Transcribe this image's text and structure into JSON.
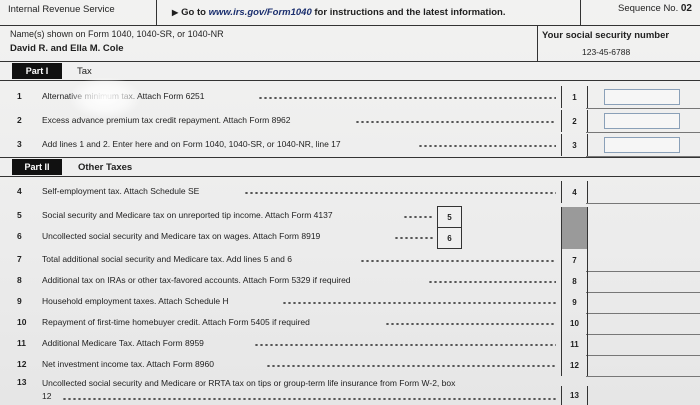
{
  "header": {
    "agency": "Internal Revenue Service",
    "instructions_prefix": "Go to",
    "instructions_url": "www.irs.gov/Form1040",
    "instructions_suffix": "for instructions and the latest information.",
    "sequence_label": "Sequence No.",
    "sequence_no": "02",
    "arrow_icon": "triangle-right"
  },
  "taxpayer": {
    "name_label": "Name(s) shown on Form 1040, 1040-SR, or 1040-NR",
    "name_value": "David R. and Ella M. Cole",
    "ssn_label": "Your social security number",
    "ssn_value": "123-45-6788"
  },
  "part1": {
    "tag": "Part I",
    "title": "Tax",
    "lines": [
      {
        "num": "1",
        "text": "Alternative minimum tax. Attach Form 6251",
        "box": "1"
      },
      {
        "num": "2",
        "text": "Excess advance premium tax credit repayment. Attach Form 8962",
        "box": "2"
      },
      {
        "num": "3",
        "text": "Add lines 1 and 2. Enter here and on Form 1040, 1040-SR, or 1040-NR, line 17",
        "box": "3"
      }
    ]
  },
  "part2": {
    "tag": "Part II",
    "title": "Other Taxes",
    "lines": [
      {
        "num": "4",
        "text": "Self-employment tax. Attach Schedule SE",
        "box": "4"
      },
      {
        "num": "5",
        "text": "Social security and Medicare tax on unreported tip income. Attach Form 4137",
        "box": "5"
      },
      {
        "num": "6",
        "text": "Uncollected social security and Medicare tax on wages. Attach Form 8919",
        "box": "6"
      },
      {
        "num": "7",
        "text": "Total additional social security and Medicare tax. Add lines 5 and 6",
        "box": "7"
      },
      {
        "num": "8",
        "text": "Additional tax on IRAs or other tax-favored accounts. Attach Form 5329 if required",
        "box": "8"
      },
      {
        "num": "9",
        "text": "Household employment taxes. Attach Schedule H",
        "box": "9"
      },
      {
        "num": "10",
        "text": "Repayment of first-time homebuyer credit. Attach Form 5405 if required",
        "box": "10"
      },
      {
        "num": "11",
        "text": "Additional Medicare Tax. Attach Form 8959",
        "box": "11"
      },
      {
        "num": "12",
        "text": "Net investment income tax. Attach Form 8960",
        "box": "12"
      },
      {
        "num": "13",
        "text": "Uncollected social security and Medicare or RRTA tax on tips or group-term life insurance from Form W-2, box",
        "text2": "12",
        "box": "13"
      }
    ]
  }
}
